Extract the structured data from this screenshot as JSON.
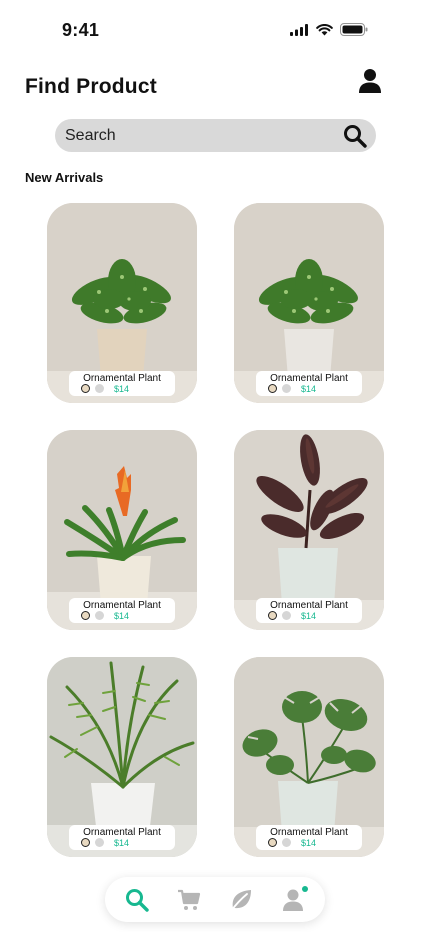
{
  "status_bar": {
    "time": "9:41"
  },
  "header": {
    "title": "Find Product",
    "profile_icon": "user-icon"
  },
  "search": {
    "placeholder": "Search",
    "icon": "search-icon"
  },
  "section": {
    "title": "New Arrivals"
  },
  "products": [
    {
      "name": "Ornamental Plant",
      "price": "$14",
      "plant": "caladium",
      "pot_color": "#e2d3bd",
      "bg": "#d8d2c9"
    },
    {
      "name": "Ornamental Plant",
      "price": "$14",
      "plant": "caladium",
      "pot_color": "#e9e6e1",
      "bg": "#d8d2c9"
    },
    {
      "name": "Ornamental Plant",
      "price": "$14",
      "plant": "bromeliad",
      "pot_color": "#efe9dc",
      "bg": "#d6d1c9"
    },
    {
      "name": "Ornamental Plant",
      "price": "$14",
      "plant": "rubber-plant",
      "pot_color": "#dfe6e1",
      "bg": "#d9d4cc"
    },
    {
      "name": "Ornamental Plant",
      "price": "$14",
      "plant": "palm",
      "pot_color": "#f2f2f0",
      "bg": "#cfcfc8"
    },
    {
      "name": "Ornamental Plant",
      "price": "$14",
      "plant": "monstera",
      "pot_color": "#dfe6e1",
      "bg": "#d6d2ca"
    }
  ],
  "swatch_colors": [
    "#e8d9c1",
    "#d6d6d6"
  ],
  "accent_color": "#17b890",
  "bottom_nav": [
    {
      "icon": "search-icon",
      "active": true
    },
    {
      "icon": "cart-icon",
      "active": false
    },
    {
      "icon": "leaf-icon",
      "active": false
    },
    {
      "icon": "user-icon",
      "active": false
    }
  ]
}
